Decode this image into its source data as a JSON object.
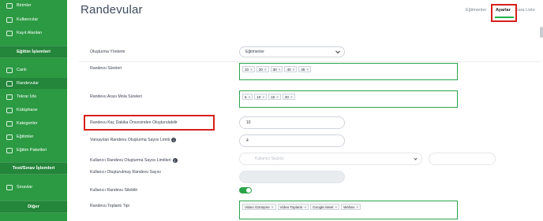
{
  "sidebar": {
    "items_top": [
      {
        "label": "Birimler",
        "icon": "building-icon"
      },
      {
        "label": "Kullanıcılar",
        "icon": "users-icon"
      },
      {
        "label": "Kayıt Alanları",
        "icon": "form-icon"
      }
    ],
    "section1": "Eğitim İşlemleri",
    "items_mid": [
      {
        "label": "Canlı",
        "icon": "live-icon"
      },
      {
        "label": "Randevular",
        "icon": "calendar-icon"
      },
      {
        "label": "Tekrar İzle",
        "icon": "replay-icon"
      },
      {
        "label": "Kütüphane",
        "icon": "library-icon"
      },
      {
        "label": "Kategoriler",
        "icon": "category-icon"
      },
      {
        "label": "Eğitimler",
        "icon": "training-icon"
      },
      {
        "label": "Eğitim Paketleri",
        "icon": "folder-icon"
      }
    ],
    "section2": "Test/Sınav İşlemleri",
    "items_exam": [
      {
        "label": "Sınavlar",
        "icon": "exam-icon"
      }
    ],
    "section3": "Diğer"
  },
  "header": {
    "title": "Randevular",
    "tabs": [
      "Eğitmenler",
      "Ayarlar",
      "Kara Liste"
    ],
    "active_tab": "Ayarlar"
  },
  "form": {
    "method_label": "Oluşturma Yöntemi",
    "method_value": "Eğitmenler",
    "durations_label": "Randevu Süreleri",
    "durations": [
      "10",
      "20",
      "30",
      "40",
      "45"
    ],
    "breaks_label": "Randevu Arası Mola Süreleri",
    "breaks": [
      "5",
      "10",
      "15",
      "20"
    ],
    "min_before_label": "Randevu Kaç Dakika Öncesinden Oluşturulabilir",
    "min_before_value": "10",
    "default_limit_label": "Varsayılan Randevu Oluşturma Sayısı Limiti",
    "default_limit_value": "4",
    "user_limit_label": "Kullanıcı Randevu Oluşturma Sayısı Limitleri",
    "user_select_placeholder": "Kullanıcı Seçiniz",
    "created_count_label": "Kullanıcı Oluşturulmuş Randevu Sayısı",
    "can_delete_label": "Kullanıcı Randevu Silebilir",
    "can_delete": true,
    "meeting_type_label": "Randevu Toplantı Tipi",
    "meeting_types": [
      "Video Görüşme",
      "Video Toplantı",
      "Google Meet",
      "Webex"
    ],
    "info_glyph": "i",
    "remove_glyph": "×"
  },
  "colors": {
    "sidebar": "#2b9a43",
    "accent": "#2aa44a",
    "highlight": "#d6201c"
  }
}
